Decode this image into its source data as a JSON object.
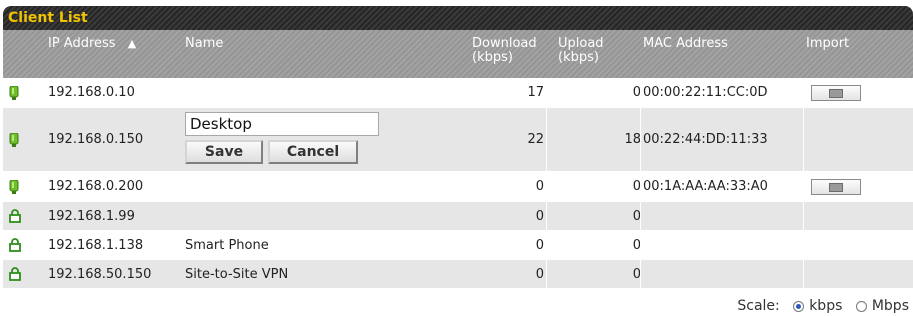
{
  "title": "Client List",
  "headers": {
    "ip": "IP Address",
    "sort_indicator": "▲",
    "name": "Name",
    "download_line1": "Download",
    "download_line2": "(kbps)",
    "upload_line1": "Upload",
    "upload_line2": "(kbps)",
    "mac": "MAC Address",
    "import": "Import"
  },
  "rows": [
    {
      "status": "online",
      "ip": "192.168.0.10",
      "name": "",
      "download": "17",
      "upload": "0",
      "mac": "00:00:22:11:CC:0D",
      "import": true
    },
    {
      "status": "online",
      "ip": "192.168.0.150",
      "name": "",
      "editing": true,
      "edit_value": "Desktop",
      "download": "22",
      "upload": "18",
      "mac": "00:22:44:DD:11:33",
      "import": false
    },
    {
      "status": "online",
      "ip": "192.168.0.200",
      "name": "",
      "download": "0",
      "upload": "0",
      "mac": "00:1A:AA:AA:33:A0",
      "import": true
    },
    {
      "status": "vpn",
      "ip": "192.168.1.99",
      "name": "",
      "download": "0",
      "upload": "0",
      "mac": "",
      "import": false
    },
    {
      "status": "vpn",
      "ip": "192.168.1.138",
      "name": "Smart Phone",
      "download": "0",
      "upload": "0",
      "mac": "",
      "import": false
    },
    {
      "status": "vpn",
      "ip": "192.168.50.150",
      "name": "Site-to-Site VPN",
      "download": "0",
      "upload": "0",
      "mac": "",
      "import": false
    }
  ],
  "edit": {
    "save_label": "Save",
    "cancel_label": "Cancel"
  },
  "scale": {
    "label": "Scale:",
    "options": [
      "kbps",
      "Mbps"
    ],
    "selected": "kbps"
  },
  "colors": {
    "title_text": "#f0c300",
    "online_icon": "#6fbf2a",
    "vpn_icon": "#2f8f1b",
    "radio_selected": "#2a59b7"
  }
}
